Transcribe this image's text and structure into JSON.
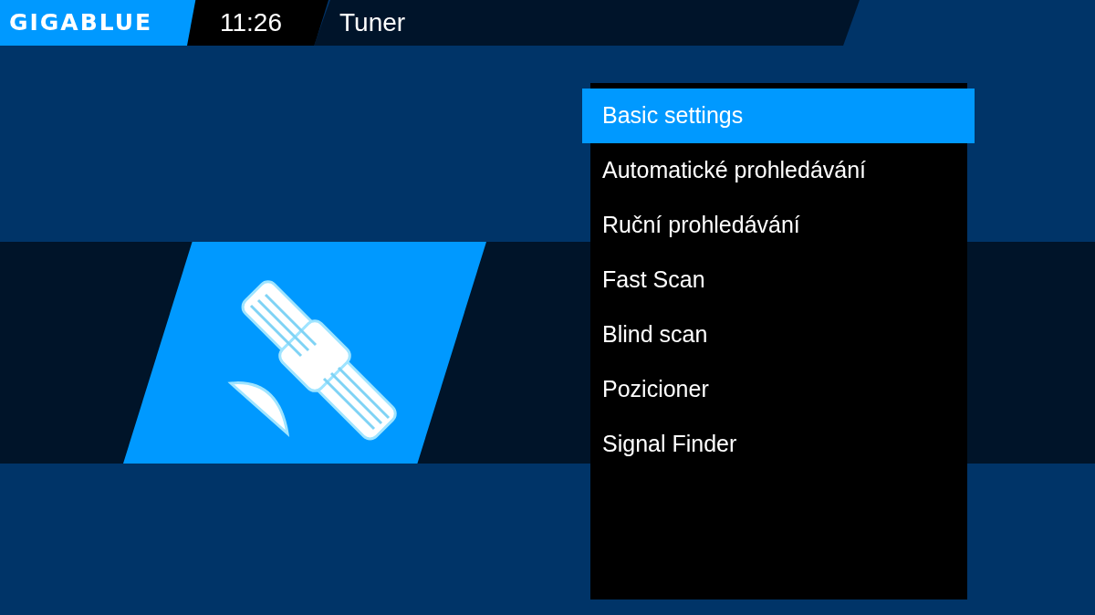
{
  "header": {
    "logo": "GIGABLUE",
    "clock": "11:26",
    "title": "Tuner"
  },
  "menu": {
    "items": [
      {
        "label": "Basic settings",
        "selected": true
      },
      {
        "label": "Automatické prohledávání",
        "selected": false
      },
      {
        "label": "Ruční prohledávání",
        "selected": false
      },
      {
        "label": "Fast Scan",
        "selected": false
      },
      {
        "label": "Blind scan",
        "selected": false
      },
      {
        "label": "Pozicioner",
        "selected": false
      },
      {
        "label": "Signal Finder",
        "selected": false
      }
    ]
  }
}
